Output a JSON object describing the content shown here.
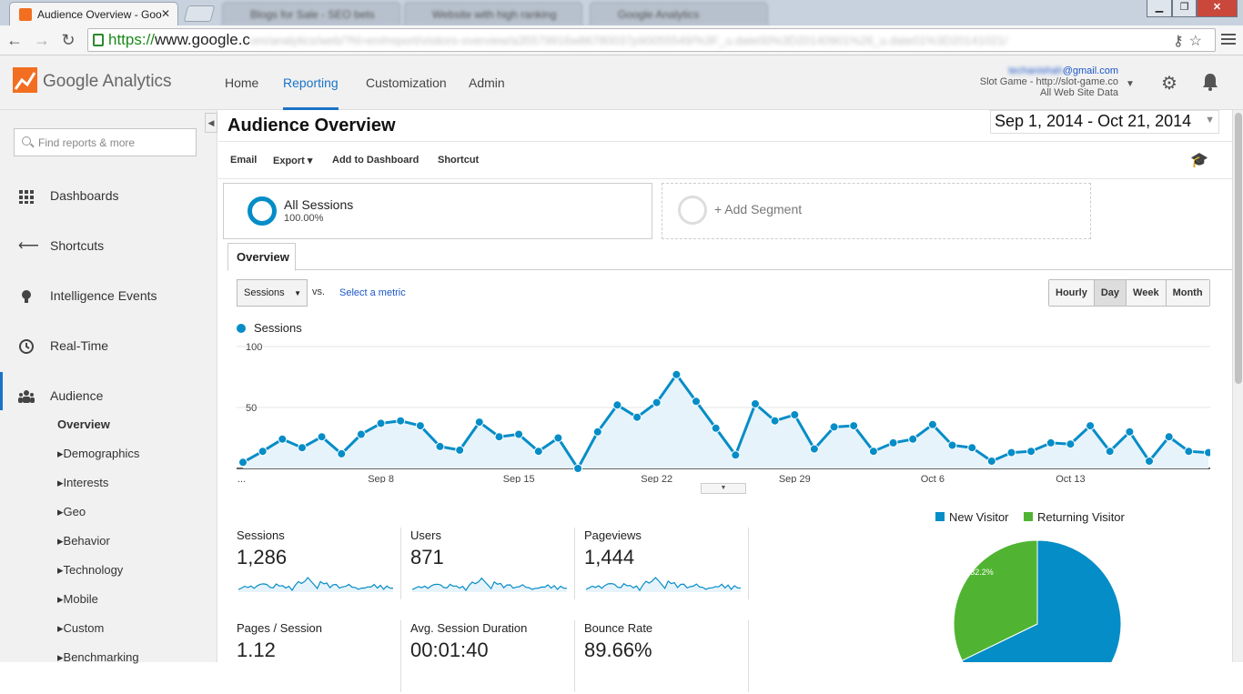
{
  "browser": {
    "active_tab_title": "Audience Overview - Goo",
    "background_tabs": [
      "Blogs for Sale - SEO bets",
      "Website with high ranking",
      "Google Analytics"
    ],
    "url_https": "https://",
    "url_domain": "www.google.c",
    "url_rest": "om/analytics/web/?hl=en#report/visitors-overview/a35579916w86780037p90055549/%3F_u.date00%3D20140901%26_u.date01%3D20141021/"
  },
  "header": {
    "logo_google": "Google",
    "logo_analytics": "Analytics",
    "nav": [
      "Home",
      "Reporting",
      "Customization",
      "Admin"
    ],
    "active_nav": "Reporting",
    "account_email_blurred": "techanishah",
    "account_email_domain": "@gmail.com",
    "account_property": "Slot Game - http://slot-game.co",
    "account_view": "All Web Site Data"
  },
  "sidebar": {
    "search_placeholder": "Find reports & more",
    "items": [
      {
        "label": "Dashboards",
        "icon": "grid-icon"
      },
      {
        "label": "Shortcuts",
        "icon": "shortcut-arrow-icon"
      },
      {
        "label": "Intelligence Events",
        "icon": "lightbulb-icon"
      },
      {
        "label": "Real-Time",
        "icon": "clock-icon"
      },
      {
        "label": "Audience",
        "icon": "people-icon"
      }
    ],
    "audience_sub": [
      "Overview",
      "Demographics",
      "Interests",
      "Geo",
      "Behavior",
      "Technology",
      "Mobile",
      "Custom",
      "Benchmarking"
    ]
  },
  "report": {
    "title": "Audience Overview",
    "date_range": "Sep 1, 2014 - Oct 21, 2014",
    "actions": [
      "Email",
      "Export",
      "Add to Dashboard",
      "Shortcut"
    ],
    "segments": {
      "all_sessions": "All Sessions",
      "all_sessions_pct": "100.00%",
      "add_segment": "+ Add Segment"
    },
    "tab": "Overview",
    "metric_select": "Sessions",
    "vs": "vs.",
    "select_metric": "Select a metric",
    "granularity": [
      "Hourly",
      "Day",
      "Week",
      "Month"
    ],
    "granularity_selected": "Day",
    "legend_series": "Sessions"
  },
  "chart_data": {
    "type": "area",
    "series": [
      {
        "name": "Sessions",
        "color": "#058dc7",
        "values": [
          5,
          14,
          24,
          17,
          26,
          12,
          28,
          37,
          39,
          35,
          18,
          15,
          38,
          26,
          28,
          14,
          25,
          0,
          30,
          52,
          42,
          54,
          77,
          55,
          33,
          11,
          53,
          39,
          44,
          16,
          34,
          35,
          14,
          21,
          24,
          36,
          19,
          17,
          6,
          13,
          14,
          21,
          20,
          35,
          14,
          30,
          6,
          26,
          14,
          13
        ]
      }
    ],
    "x_start_date": "Sep 1, 2014",
    "x_tick_labels": [
      "...",
      "Sep 8",
      "Sep 15",
      "Sep 22",
      "Sep 29",
      "Oct 6",
      "Oct 13"
    ],
    "y_tick_labels": [
      "100",
      "50"
    ],
    "ylim": [
      0,
      100
    ],
    "grid": true
  },
  "stats": [
    {
      "label": "Sessions",
      "value": "1,286"
    },
    {
      "label": "Users",
      "value": "871"
    },
    {
      "label": "Pageviews",
      "value": "1,444"
    },
    {
      "label": "Pages / Session",
      "value": "1.12"
    },
    {
      "label": "Avg. Session Duration",
      "value": "00:01:40"
    },
    {
      "label": "Bounce Rate",
      "value": "89.66%"
    }
  ],
  "pie": {
    "legend": [
      {
        "label": "New Visitor",
        "color": "#058dc7"
      },
      {
        "label": "Returning Visitor",
        "color": "#50b432"
      }
    ],
    "slices": [
      {
        "label": "67.8%",
        "value": 67.8,
        "color": "#058dc7"
      },
      {
        "label": "32.2%",
        "value": 32.2,
        "color": "#50b432"
      }
    ]
  },
  "colors": {
    "accent": "#1a73c8",
    "series": "#058dc7",
    "returning": "#50b432"
  }
}
